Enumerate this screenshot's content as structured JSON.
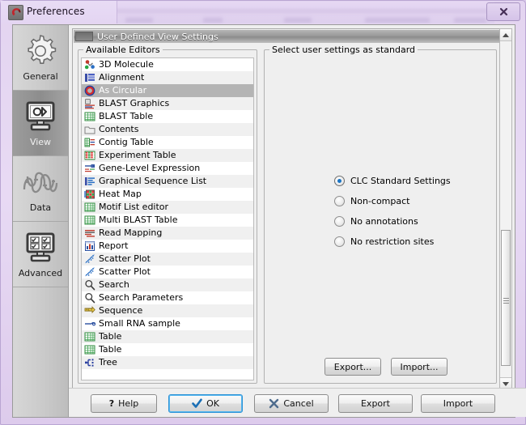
{
  "window": {
    "title": "Preferences",
    "app_icon": "clc-logo-icon",
    "close_label": "✕"
  },
  "sidebar": {
    "items": [
      {
        "label": "General",
        "icon": "gear-icon",
        "selected": false
      },
      {
        "label": "View",
        "icon": "monitor-view-icon",
        "selected": true
      },
      {
        "label": "Data",
        "icon": "dna-helix-icon",
        "selected": false
      },
      {
        "label": "Advanced",
        "icon": "monitor-advanced-icon",
        "selected": false
      }
    ]
  },
  "section": {
    "header": "User Defined View Settings"
  },
  "editors_panel": {
    "title": "Available Editors",
    "items": [
      {
        "label": "3D Molecule",
        "icon": "molecule-icon",
        "selected": false
      },
      {
        "label": "Alignment",
        "icon": "alignment-icon",
        "selected": false
      },
      {
        "label": "As Circular",
        "icon": "circular-icon",
        "selected": true
      },
      {
        "label": "BLAST Graphics",
        "icon": "blast-graphics-icon",
        "selected": false
      },
      {
        "label": "BLAST Table",
        "icon": "table-green-icon",
        "selected": false
      },
      {
        "label": "Contents",
        "icon": "folder-icon",
        "selected": false
      },
      {
        "label": "Contig Table",
        "icon": "contig-table-icon",
        "selected": false
      },
      {
        "label": "Experiment Table",
        "icon": "experiment-table-icon",
        "selected": false
      },
      {
        "label": "Gene-Level Expression",
        "icon": "gene-expression-icon",
        "selected": false
      },
      {
        "label": "Graphical Sequence List",
        "icon": "graphical-seq-list-icon",
        "selected": false
      },
      {
        "label": "Heat Map",
        "icon": "heatmap-icon",
        "selected": false
      },
      {
        "label": "Motif List editor",
        "icon": "table-green-icon",
        "selected": false
      },
      {
        "label": "Multi BLAST Table",
        "icon": "table-green-icon",
        "selected": false
      },
      {
        "label": "Read Mapping",
        "icon": "read-mapping-icon",
        "selected": false
      },
      {
        "label": "Report",
        "icon": "report-icon",
        "selected": false
      },
      {
        "label": "Scatter Plot",
        "icon": "scatter-plot-icon",
        "selected": false
      },
      {
        "label": "Scatter Plot",
        "icon": "scatter-plot-icon",
        "selected": false
      },
      {
        "label": "Search",
        "icon": "magnifier-icon",
        "selected": false
      },
      {
        "label": "Search Parameters",
        "icon": "magnifier-icon",
        "selected": false
      },
      {
        "label": "Sequence",
        "icon": "sequence-icon",
        "selected": false
      },
      {
        "label": "Small RNA sample",
        "icon": "small-rna-icon",
        "selected": false
      },
      {
        "label": "Table",
        "icon": "table-green-icon",
        "selected": false
      },
      {
        "label": "Table",
        "icon": "table-green-icon",
        "selected": false
      },
      {
        "label": "Tree",
        "icon": "tree-icon",
        "selected": false
      }
    ]
  },
  "settings_panel": {
    "title": "Select user settings as standard",
    "options": [
      {
        "label": "CLC Standard Settings",
        "selected": true
      },
      {
        "label": "Non-compact",
        "selected": false
      },
      {
        "label": "No annotations",
        "selected": false
      },
      {
        "label": "No restriction sites",
        "selected": false
      }
    ],
    "export_label": "Export...",
    "import_label": "Import..."
  },
  "footer": {
    "help_label": "Help",
    "ok_label": "OK",
    "cancel_label": "Cancel",
    "export_label": "Export",
    "import_label": "Import"
  },
  "colors": {
    "titlebar": "#e5d6f2",
    "accent_focus": "#2f93d6",
    "selection": "#b4b4b4",
    "radio_dot": "#1a74c4"
  }
}
